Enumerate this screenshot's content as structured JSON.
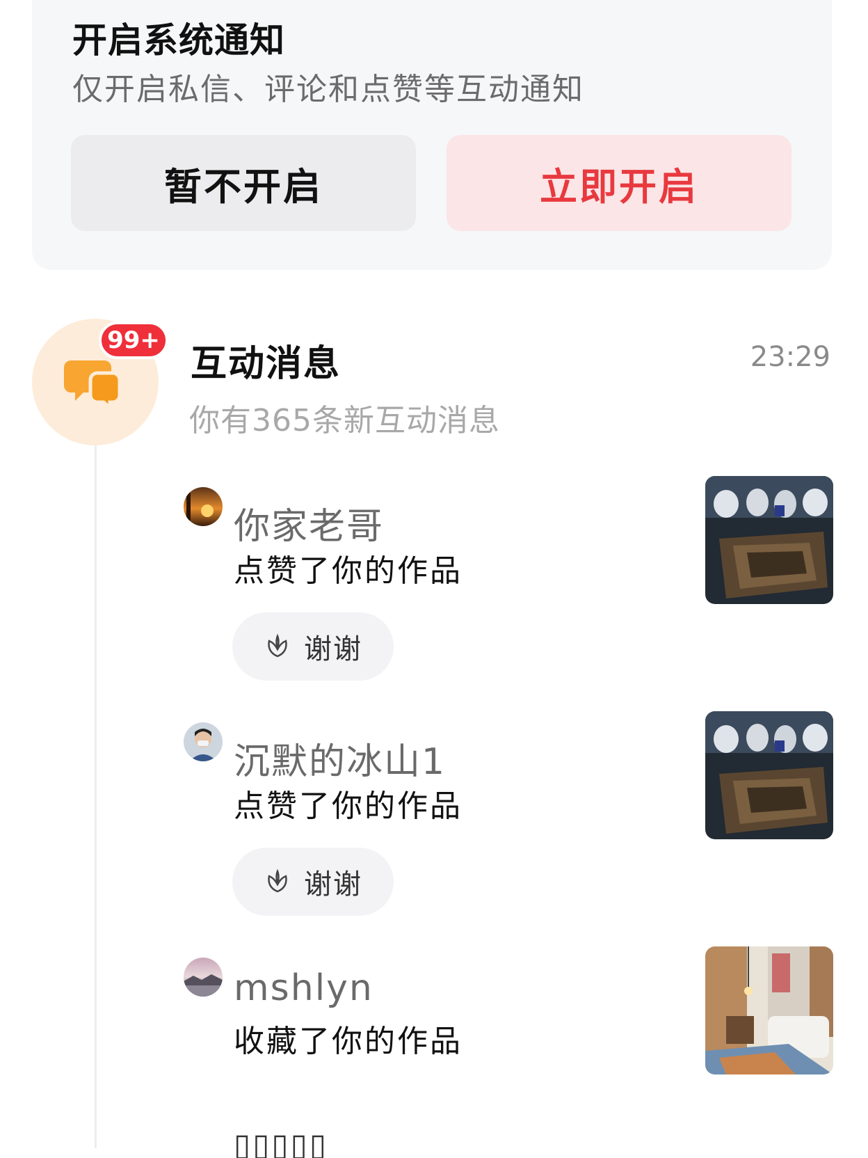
{
  "notification_prompt": {
    "title": "开启系统通知",
    "subtitle": "仅开启私信、评论和点赞等互动通知",
    "decline_label": "暂不开启",
    "accept_label": "立即开启"
  },
  "interaction_group": {
    "badge": "99+",
    "title": "互动消息",
    "time": "23:29",
    "subtitle": "你有365条新互动消息"
  },
  "items": [
    {
      "username": "你家老哥",
      "action": "点赞了你的作品",
      "thanks_label": "谢谢"
    },
    {
      "username": "沉默的冰山1",
      "action": "点赞了你的作品",
      "thanks_label": "谢谢"
    },
    {
      "username": "mshlyn",
      "action": "收藏了你的作品"
    }
  ],
  "colors": {
    "accent_red": "#e8393f",
    "badge_red": "#ef2f3a",
    "icon_orange": "#f8a531"
  }
}
